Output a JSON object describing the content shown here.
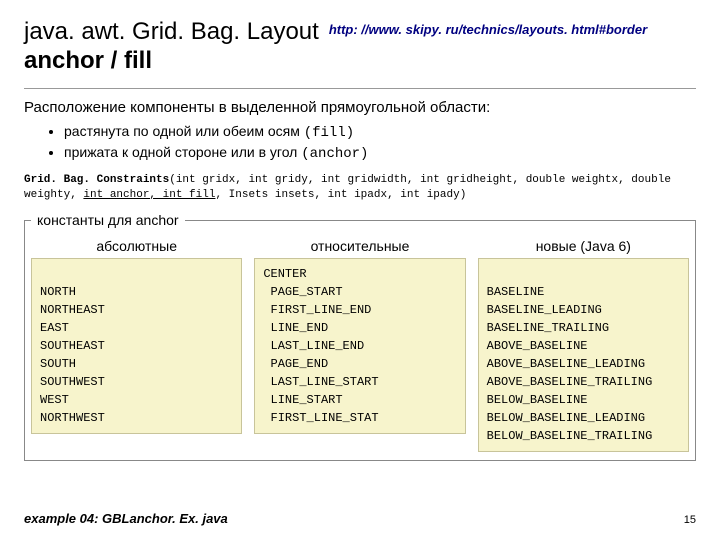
{
  "header": {
    "title_line1": "java. awt. Grid. Bag. Layout",
    "title_line2": "anchor / fill",
    "url": "http: //www. skipy. ru/technics/layouts. html#border"
  },
  "subheading": "Расположение компоненты в выделенной прямоугольной области:",
  "bullets": [
    {
      "text": "растянута по одной или обеим осям ",
      "code": "(fill)"
    },
    {
      "text": "прижата к одной стороне или в угол ",
      "code": "(anchor)"
    }
  ],
  "signature": {
    "prefix": "Grid. Bag. Constraints",
    "part1": "(int gridx, int gridy, int gridwidth, int gridheight, double weightx, double weighty, ",
    "ul": "int anchor, int fill",
    "part2": ", Insets insets, int ipadx, int ipady)"
  },
  "constants": {
    "legend": "константы для anchor",
    "columns": [
      {
        "heading": "абсолютные",
        "items": [
          "",
          "NORTH",
          "NORTHEAST",
          "EAST",
          "SOUTHEAST",
          "SOUTH",
          "SOUTHWEST",
          "WEST",
          "NORTHWEST"
        ]
      },
      {
        "heading": "относительные",
        "items": [
          "CENTER",
          " PAGE_START",
          " FIRST_LINE_END",
          " LINE_END",
          " LAST_LINE_END",
          " PAGE_END",
          " LAST_LINE_START",
          " LINE_START",
          " FIRST_LINE_STAT"
        ]
      },
      {
        "heading": "новые  (Java 6)",
        "items": [
          "",
          "BASELINE",
          "BASELINE_LEADING",
          "BASELINE_TRAILING",
          "ABOVE_BASELINE",
          "ABOVE_BASELINE_LEADING",
          "ABOVE_BASELINE_TRAILING",
          "BELOW_BASELINE",
          "BELOW_BASELINE_LEADING",
          "BELOW_BASELINE_TRAILING"
        ]
      }
    ]
  },
  "footer": "example 04: GBLanchor. Ex. java",
  "page_number": "15"
}
